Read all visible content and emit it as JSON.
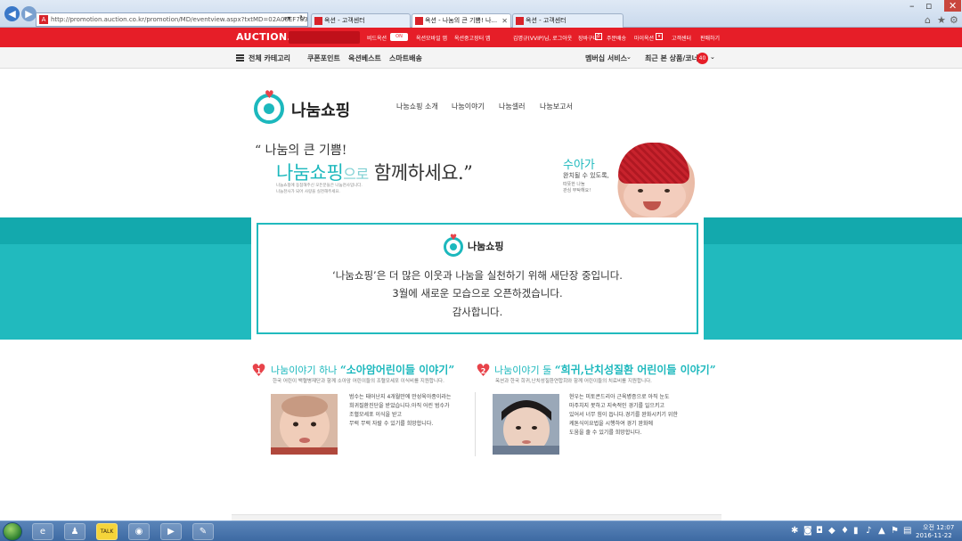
{
  "browser": {
    "url": "http://promotion.auction.co.kr/promotion/MD/eventview.aspx?txtMD=02A06EF783&",
    "tabs": [
      {
        "label": "옥션 - 고객센터"
      },
      {
        "label": "옥션 - 나눔의 큰 기쁨! 나..."
      },
      {
        "label": "옥션 - 고객센터"
      }
    ],
    "back_icon": "back-arrow-icon",
    "forward_icon": "forward-arrow-icon"
  },
  "auction_nav": {
    "logo": "AUCTION.",
    "bidoksyeon": "비드옥션",
    "on": "ON",
    "links": [
      "옥션모바일 앱",
      "옥션중고장터 앱",
      "김명규(VVIP)님, 로그아웃",
      "장바구니",
      "주문배송",
      "마이옥션",
      "고객센터",
      "판매하기"
    ],
    "cart_count": "0"
  },
  "category_bar": {
    "all_categories": "전체 카테고리",
    "items": [
      "쿠폰포인트",
      "옥션베스트",
      "스마트배송"
    ],
    "membership": "멤버십 서비스",
    "recent": "최근 본 상품/코너",
    "recent_count": "40"
  },
  "nanum": {
    "logo_text": "나눔쇼핑",
    "menu": [
      "나눔쇼핑 소개",
      "나눔이야기",
      "나눔셀러",
      "나눔보고서"
    ],
    "hero_line1": "“ 나눔의 큰 기쁨!",
    "hero_teal": "나눔쇼핑",
    "hero_light": "으로",
    "hero_rest": " 함께하세요.”",
    "hero_small1": "나눔쇼핑에 동참해주신 모든분들은 나눔천사입니다.",
    "hero_small2": "나눔천사가 되어 사랑을 실천해주세요.",
    "baby_name": "수아가",
    "baby_caption1": "완치될 수 있도록,",
    "baby_caption2": "따뜻한 나눔",
    "baby_caption3": "관심 부탁해요!"
  },
  "notice": {
    "logo_text": "나눔쇼핑",
    "line1": "‘나눔쇼핑’은 더 많은 이웃과 나눔을 실천하기 위해 새단장 중입니다.",
    "line2": "3월에 새로운 모습으로 오픈하겠습니다.",
    "line3": "감사합니다."
  },
  "stories": [
    {
      "num": "1",
      "title_prefix": "나눔이야기 하나",
      "title_main": "“소아암어린이들 이야기”",
      "subtitle": "한국 어린이 백혈병재단과 함께 소아암 어린이들의 조혈모세포 이식비를 지원합니다.",
      "text": [
        "범수는 태어난지 4개월만에 만성육아종이라는",
        "희귀질환진단을 받았습니다.아직 어린 범수가",
        "조혈모세포 이식을 받고",
        "무럭 무럭 자랄 수 있기를 희망합니다."
      ]
    },
    {
      "num": "2",
      "title_prefix": "나눔이야기 둘",
      "title_main": "“희귀,난치성질환 어린이들 이야기”",
      "subtitle": "옥션과 한국 희귀,난치성질환연합회와 함께 어린이들의 치료비를 지원합니다.",
      "text": [
        "현우는 미토콘드리아 근육병증으로 아직 눈도",
        "마주치지 못하고 지속적인 경기를 일으키고",
        "있어서 너무 힘이 듭니다.경기를 완화시키기 위한",
        "케톤식이요법을 시행하여 경기 완화에",
        "도움을 줄 수 있기를 희망합니다."
      ]
    }
  ],
  "taskbar": {
    "time": "오전 12:07",
    "date": "2016-11-22"
  },
  "colors": {
    "auction_red": "#e61e28",
    "teal": "#21babe",
    "heart_red": "#e8434a"
  }
}
